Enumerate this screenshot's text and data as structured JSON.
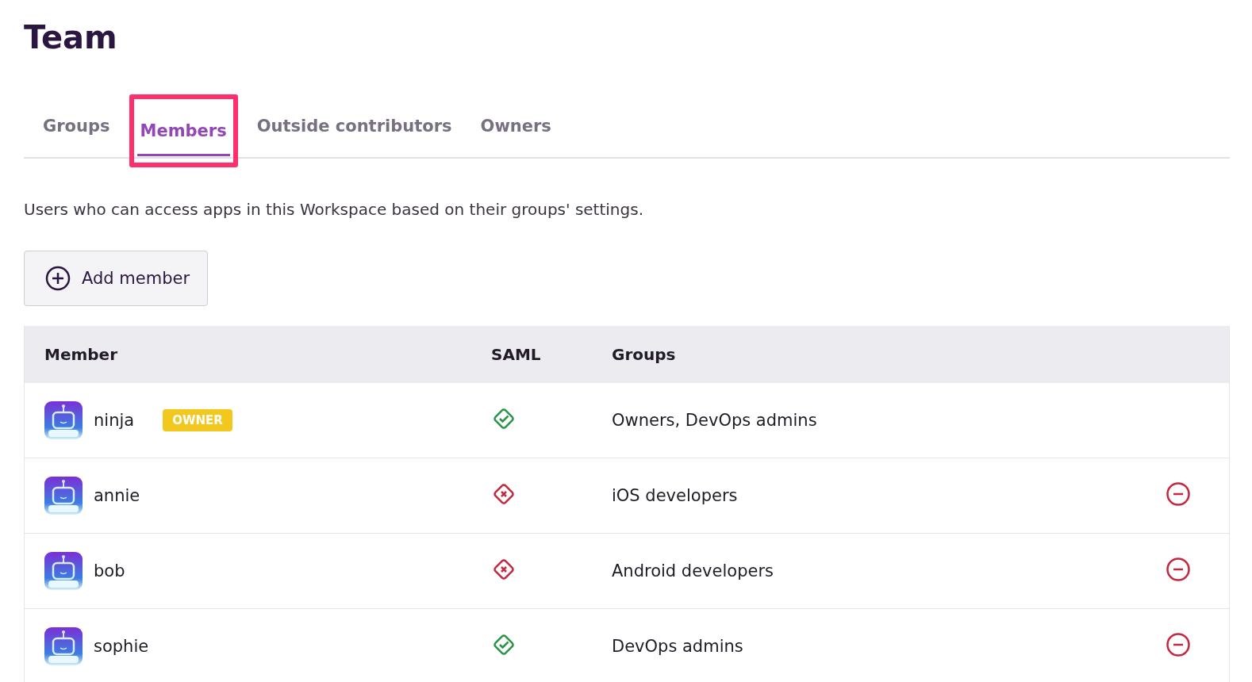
{
  "title": "Team",
  "tabs": [
    {
      "label": "Groups",
      "selected": false,
      "highlighted": false
    },
    {
      "label": "Members",
      "selected": true,
      "highlighted": true
    },
    {
      "label": "Outside contributors",
      "selected": false,
      "highlighted": false
    },
    {
      "label": "Owners",
      "selected": false,
      "highlighted": false
    }
  ],
  "description": "Users who can access apps in this Workspace based on their groups' settings.",
  "add_button": "Add member",
  "table": {
    "columns": [
      "Member",
      "SAML",
      "Groups"
    ],
    "rows": [
      {
        "member": "ninja",
        "badge": "OWNER",
        "saml": true,
        "groups": "Owners, DevOps admins",
        "removable": false
      },
      {
        "member": "annie",
        "saml": false,
        "groups": "iOS developers",
        "removable": true
      },
      {
        "member": "bob",
        "saml": false,
        "groups": "Android developers",
        "removable": true
      },
      {
        "member": "sophie",
        "saml": true,
        "groups": "DevOps admins",
        "removable": true
      }
    ]
  }
}
